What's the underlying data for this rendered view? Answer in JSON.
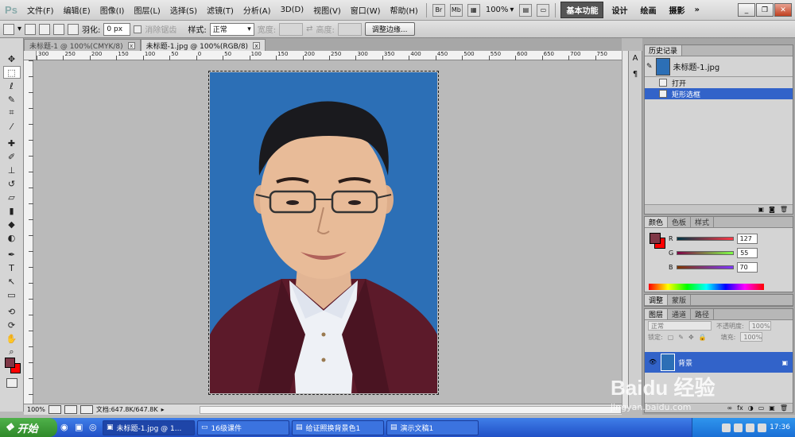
{
  "app": {
    "logo": "Ps"
  },
  "menubar": {
    "items": [
      "文件(F)",
      "编辑(E)",
      "图像(I)",
      "图层(L)",
      "选择(S)",
      "滤镜(T)",
      "分析(A)",
      "3D(D)",
      "视图(V)",
      "窗口(W)",
      "帮助(H)"
    ],
    "zoom": "100%",
    "workspaces": [
      "基本功能",
      "设计",
      "绘画",
      "摄影"
    ],
    "more": "»"
  },
  "options": {
    "feather_label": "羽化:",
    "feather_value": "0 px",
    "antialias_label": "消除锯齿",
    "style_label": "样式:",
    "style_value": "正常",
    "width_label": "宽度:",
    "height_label": "高度:",
    "refine_button": "调整边缘..."
  },
  "doc_tabs": [
    {
      "label": "未标题-1 @ 100%(CMYK/8)",
      "active": false
    },
    {
      "label": "未标题-1.jpg @ 100%(RGB/8)",
      "active": true
    }
  ],
  "ruler": {
    "ticks": [
      "300",
      "250",
      "200",
      "150",
      "100",
      "50",
      "0",
      "50",
      "100",
      "150",
      "200",
      "250",
      "300",
      "350",
      "400",
      "450",
      "500",
      "550",
      "600",
      "650",
      "700",
      "750"
    ]
  },
  "status": {
    "zoom": "100%",
    "doc": "文档:647.8K/647.8K"
  },
  "history": {
    "tabs": [
      "历史记录"
    ],
    "snapshot": "未标题-1.jpg",
    "steps": [
      {
        "label": "打开",
        "selected": false
      },
      {
        "label": "矩形选框",
        "selected": true
      }
    ]
  },
  "color": {
    "tabs": [
      "颜色",
      "色板",
      "样式"
    ],
    "foreground": "#7f3746",
    "background": "#ff0000",
    "r_label": "R",
    "r": "127",
    "g_label": "G",
    "g": "55",
    "b_label": "B",
    "b": "70"
  },
  "adjust": {
    "tabs": [
      "调整",
      "蒙版"
    ]
  },
  "layers": {
    "tabs": [
      "图层",
      "通道",
      "路径"
    ],
    "blend": "正常",
    "opacity_label": "不透明度:",
    "opacity": "100%",
    "lock_label": "锁定:",
    "fill_label": "填充:",
    "fill": "100%",
    "layer_name": "背景"
  },
  "taskbar": {
    "start": "开始",
    "tasks": [
      "未标题-1.jpg @ 1...",
      "16级课件",
      "给证照换背景色1",
      "演示文稿1"
    ],
    "time": "17:36"
  },
  "watermark": {
    "brand": "Baidu 经验",
    "url": "jingyan.baidu.com"
  }
}
